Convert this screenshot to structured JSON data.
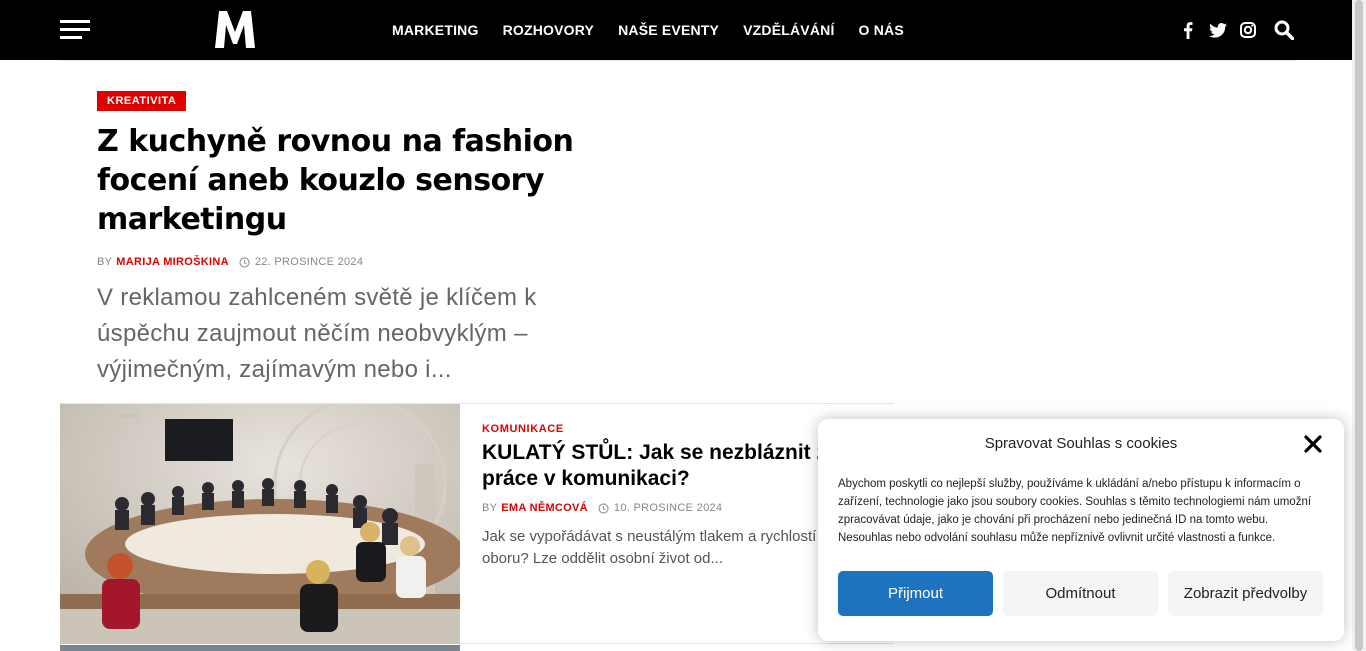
{
  "header": {
    "menu_icon": "hamburger-menu-icon",
    "logo_letter": "M",
    "nav": [
      "MARKETING",
      "ROZHOVORY",
      "NAŠE EVENTY",
      "VZDĚLÁVÁNÍ",
      "O NÁS"
    ],
    "social_icons": [
      "facebook-icon",
      "twitter-icon",
      "instagram-icon"
    ],
    "search_icon": "search-icon",
    "background": "#000000"
  },
  "featured": {
    "category": "KREATIVITA",
    "title": "Z kuchyně rovnou na fashion focení aneb kouzlo sensory marketingu",
    "by_label": "BY",
    "author": "MARIJA MIROŠKINA",
    "date": "22. PROSINCE 2024",
    "excerpt": "V reklamou zahlceném světě je klíčem k úspěchu zaujmout něčím neobvyklým – výjimečným, zajímavým nebo i..."
  },
  "article": {
    "category": "KOMUNIKACE",
    "title": "KULATÝ STŮL: Jak se nezbláznit z práce v komunikaci?",
    "by_label": "BY",
    "author": "EMA NĚMCOVÁ",
    "date": "10. PROSINCE 2024",
    "excerpt": "Jak se vypořádávat s neustálým tlakem a rychlostí změn v oboru? Lze oddělit osobní život od..."
  },
  "cookie": {
    "title": "Spravovat Souhlas s cookies",
    "text": "Abychom poskytli co nejlepší služby, používáme k ukládání a/nebo přístupu k informacím o zařízení, technologie jako jsou soubory cookies. Souhlas s těmito technologiemi nám umožní zpracovávat údaje, jako je chování při procházení nebo jedinečná ID na tomto webu. Nesouhlas nebo odvolání souhlasu může nepříznivě ovlivnit určité vlastnosti a funkce.",
    "accept": "Přijmout",
    "deny": "Odmítnout",
    "preferences": "Zobrazit předvolby",
    "accent": "#1e73be"
  },
  "colors": {
    "accent_red": "#e10000"
  }
}
